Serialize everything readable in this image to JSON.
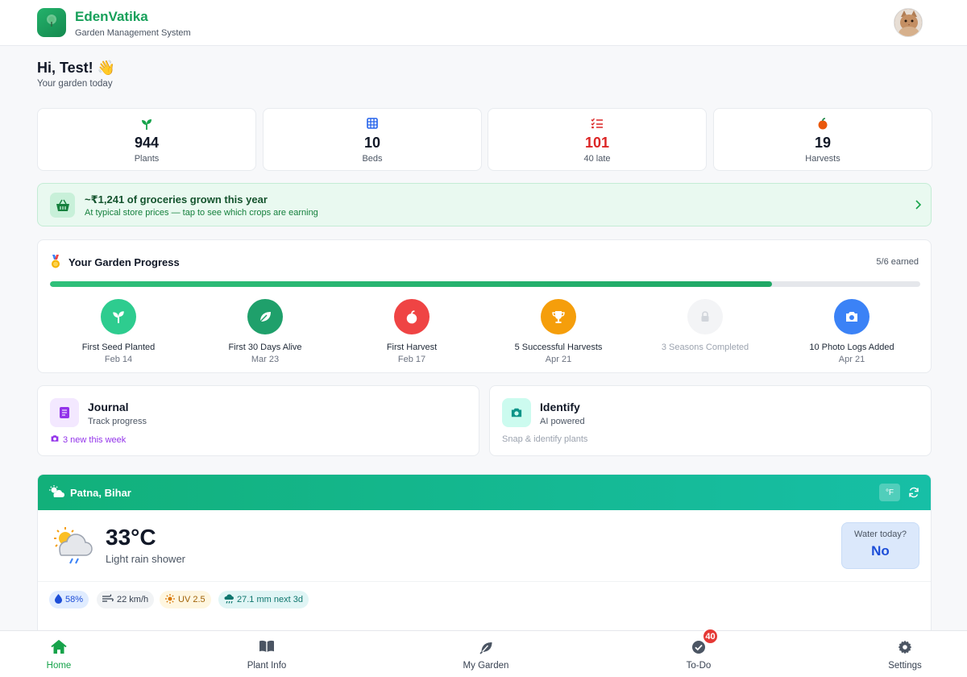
{
  "header": {
    "brand_name": "EdenVatika",
    "brand_sub": "Garden Management System",
    "logo_icon": "tree-icon",
    "avatar_icon": "cat-avatar"
  },
  "greeting": {
    "title": "Hi, Test! 👋",
    "subtitle": "Your garden today"
  },
  "stats": [
    {
      "icon": "sprout-icon",
      "value": "944",
      "label": "Plants",
      "color": "#16a34a"
    },
    {
      "icon": "grid-icon",
      "value": "10",
      "label": "Beds",
      "color": "#2563eb"
    },
    {
      "icon": "checklist-icon",
      "value": "101",
      "label": "40 late",
      "color": "#dc2626"
    },
    {
      "icon": "apple-icon",
      "value": "19",
      "label": "Harvests",
      "color": "#ea580c"
    }
  ],
  "groceries": {
    "title": "~₹1,241 of groceries grown this year",
    "subtitle": "At typical store prices — tap to see which crops are earning",
    "icon": "basket-icon"
  },
  "progress": {
    "title": "Your Garden Progress",
    "earned": "5/6 earned",
    "fill_fraction": 0.83,
    "milestones": [
      {
        "name": "First Seed Planted",
        "date": "Feb 14",
        "icon": "sprout-icon",
        "color": "#2ecc8f",
        "locked": false
      },
      {
        "name": "First 30 Days Alive",
        "date": "Mar 23",
        "icon": "leaf-icon",
        "color": "#1fa06b",
        "locked": false
      },
      {
        "name": "First Harvest",
        "date": "Feb 17",
        "icon": "apple-icon",
        "color": "#ef4444",
        "locked": false
      },
      {
        "name": "5 Successful Harvests",
        "date": "Apr 21",
        "icon": "trophy-icon",
        "color": "#f59e0b",
        "locked": false
      },
      {
        "name": "3 Seasons Completed",
        "date": "",
        "icon": "lock-icon",
        "color": "#f3f4f6",
        "locked": true
      },
      {
        "name": "10 Photo Logs Added",
        "date": "Apr 21",
        "icon": "camera-icon",
        "color": "#3b82f6",
        "locked": false
      }
    ]
  },
  "journal": {
    "title": "Journal",
    "subtitle": "Track progress",
    "footer": "3 new this week",
    "accent": "#9333ea"
  },
  "identify": {
    "title": "Identify",
    "subtitle": "AI powered",
    "footer": "Snap & identify plants",
    "accent": "#0d9488"
  },
  "weather": {
    "location": "Patna, Bihar",
    "unit_toggle": "°F",
    "temp": "33°C",
    "description": "Light rain shower",
    "water_question": "Water today?",
    "water_answer": "No",
    "chips": [
      {
        "icon": "droplet-icon",
        "text": "58%"
      },
      {
        "icon": "wind-icon",
        "text": "22 km/h"
      },
      {
        "icon": "sun-icon",
        "text": "UV 2.5"
      },
      {
        "icon": "rain-icon",
        "text": "27.1 mm next 3d"
      }
    ]
  },
  "nav": {
    "items": [
      {
        "label": "Home",
        "icon": "home-icon"
      },
      {
        "label": "Plant Info",
        "icon": "book-icon"
      },
      {
        "label": "My Garden",
        "icon": "leaf-icon"
      },
      {
        "label": "To-Do",
        "icon": "check-circle-icon"
      },
      {
        "label": "Settings",
        "icon": "gear-icon"
      }
    ],
    "todo_badge": "40",
    "active": "Home"
  }
}
